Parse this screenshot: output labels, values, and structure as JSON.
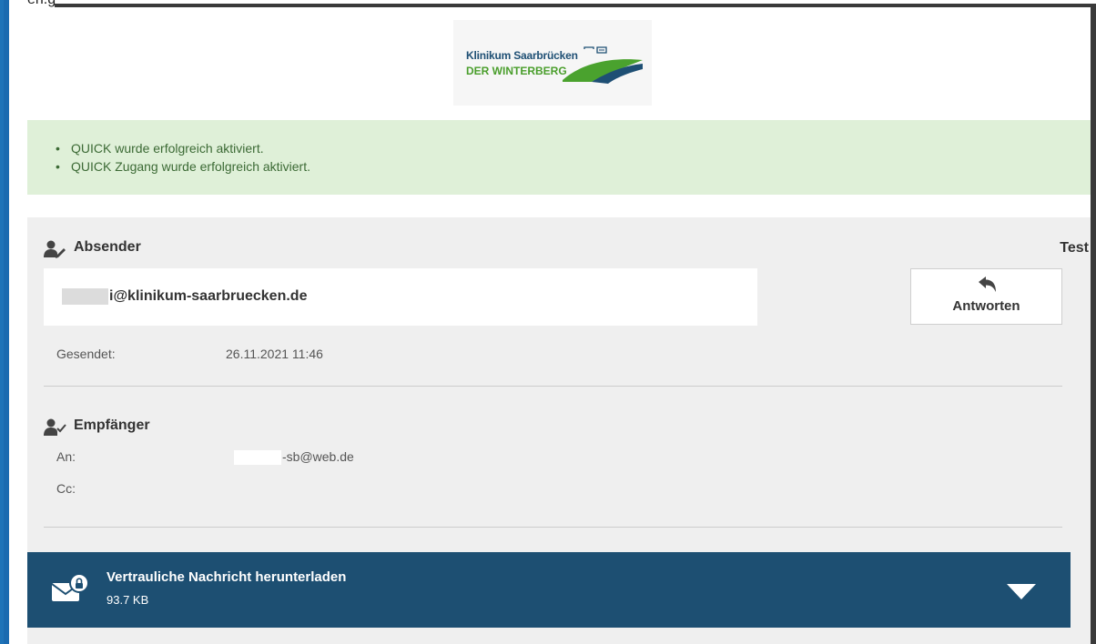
{
  "header_cut_text": "en.g",
  "logo": {
    "line1": "Klinikum Saarbrücken",
    "line2": "DER WINTERBERG"
  },
  "alerts": [
    "QUICK wurde erfolgreich aktiviert.",
    "QUICK Zugang wurde erfolgreich aktiviert."
  ],
  "sender": {
    "title": "Absender",
    "subject": "Test",
    "email_visible": "i@klinikum-saarbruecken.de",
    "sent_label": "Gesendet:",
    "sent_value": "26.11.2021 11:46"
  },
  "reply_button": {
    "label": "Antworten",
    "icon": "reply-arrow-icon"
  },
  "recipient": {
    "title": "Empfänger",
    "to_label": "An:",
    "to_value_visible": "-sb@web.de",
    "cc_label": "Cc:",
    "cc_value": ""
  },
  "download": {
    "title": "Vertrauliche Nachricht herunterladen",
    "size": "93.7 KB",
    "icon": "locked-mail-icon"
  },
  "colors": {
    "frame_blue": "#1e73b8",
    "alert_bg": "#dff0d8",
    "alert_text": "#3c6a35",
    "panel_bg": "#efefef",
    "download_bar": "#1d4f72",
    "logo_navy": "#1e4f74",
    "logo_green": "#4a9e2c"
  }
}
